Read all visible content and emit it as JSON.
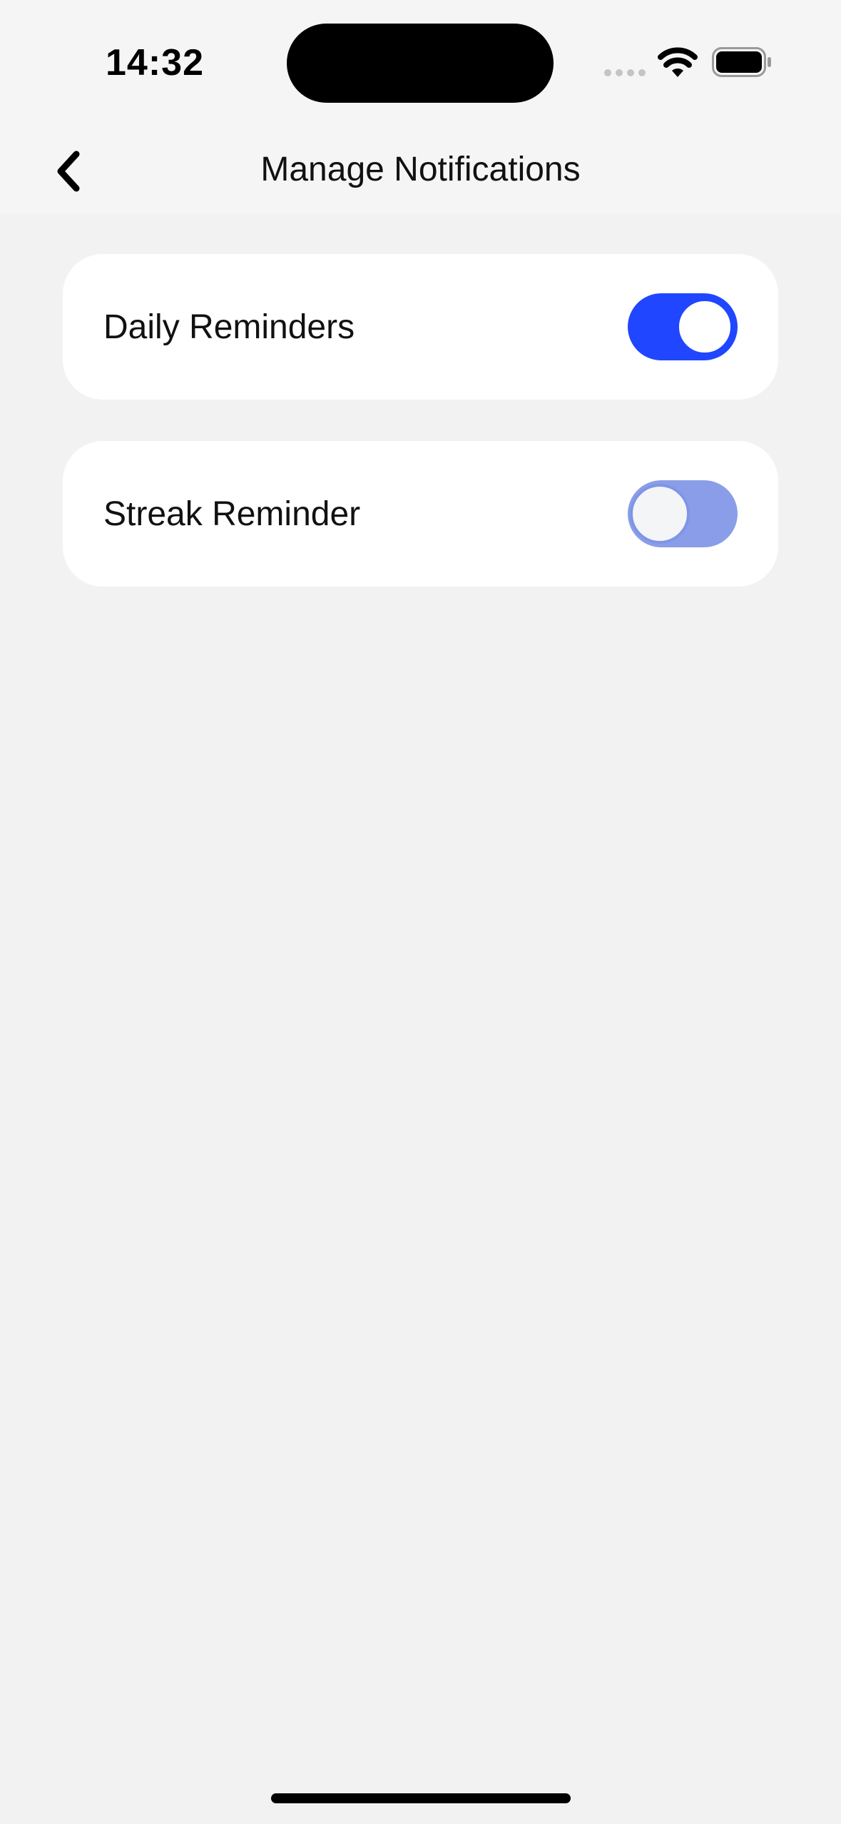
{
  "status_bar": {
    "time": "14:32"
  },
  "nav": {
    "title": "Manage Notifications",
    "back_icon": "chevron-left-icon"
  },
  "settings": [
    {
      "label": "Daily Reminders",
      "enabled": true
    },
    {
      "label": "Streak Reminder",
      "enabled": false
    }
  ],
  "colors": {
    "accent": "#2046ff",
    "toggle_off": "#8a9de8",
    "background": "#f2f2f2",
    "card": "#ffffff"
  }
}
